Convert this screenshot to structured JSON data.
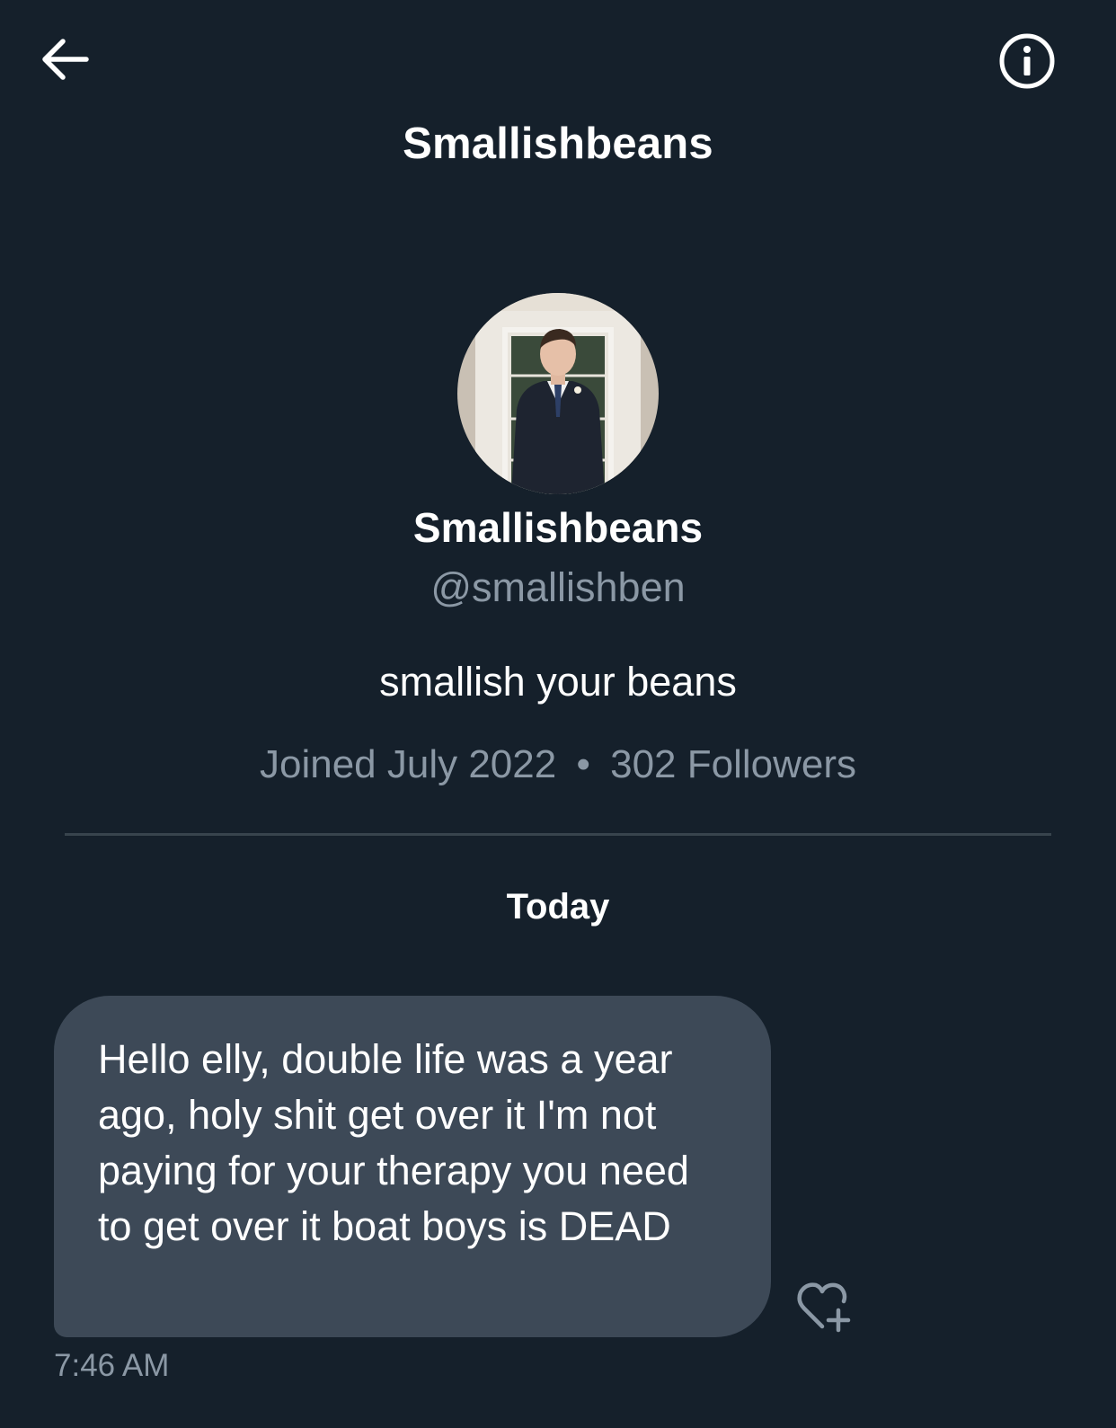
{
  "header": {
    "title": "Smallishbeans",
    "back_icon": "back-arrow-icon",
    "info_icon": "info-icon"
  },
  "profile": {
    "display_name": "Smallishbeans",
    "handle": "@smallishben",
    "bio": "smallish your beans",
    "joined": "Joined July 2022",
    "separator": "•",
    "followers": "302 Followers",
    "avatar_alt": "profile-photo"
  },
  "conversation": {
    "day_label": "Today",
    "messages": [
      {
        "text": "Hello elly, double life was a year ago, holy shit get over it I'm not paying for your therapy you need to get over it boat boys is DEAD",
        "time": "7:46 AM",
        "reaction_icon": "add-reaction-heart-icon"
      }
    ]
  },
  "colors": {
    "background": "#15202b",
    "bubble": "#3d4957",
    "secondary_text": "#8b98a5",
    "divider": "#38444d"
  }
}
